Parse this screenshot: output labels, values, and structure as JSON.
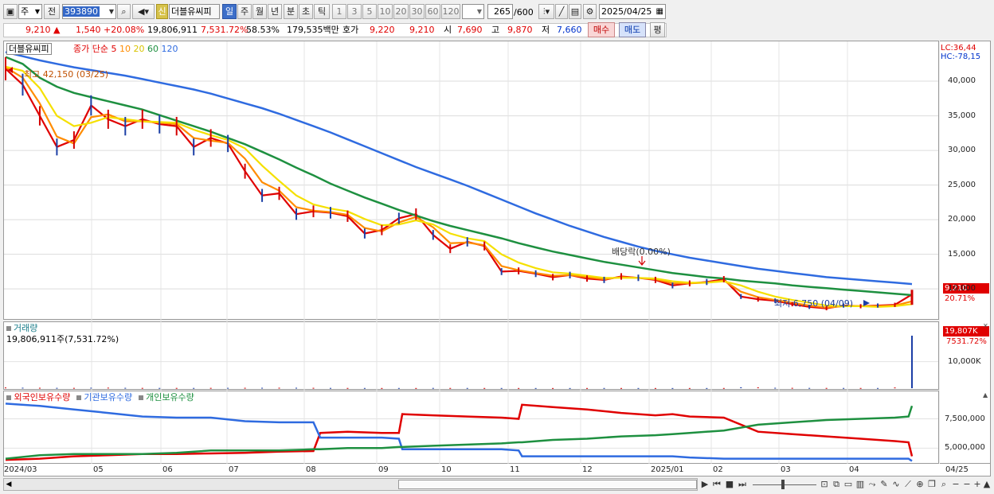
{
  "toolbar": {
    "icon_left": "screen-icon",
    "market_select": "주",
    "prev_label": "전",
    "code": "393890",
    "new_label": "신",
    "stock_name": "더블유씨피",
    "periods": [
      "일",
      "주",
      "월",
      "년",
      "분",
      "초",
      "틱"
    ],
    "active_period": "일",
    "intervals": [
      "1",
      "3",
      "5",
      "10",
      "20",
      "30",
      "60",
      "120"
    ],
    "count": "265",
    "count_max": "/600",
    "date": "2025/04/25"
  },
  "quote": {
    "price": "9,210",
    "change": "1,540",
    "change_pct": "+20.08%",
    "volume": "19,806,911",
    "volume_ratio": "7,531.72%",
    "turnover_pct": "58.53%",
    "amount": "179,535백만",
    "ask_label": "호가",
    "ask": "9,220",
    "bid": "9,210",
    "open_label": "시",
    "open": "7,690",
    "high_label": "고",
    "high": "9,870",
    "low_label": "저",
    "low": "7,660",
    "buy_label": "매수",
    "sell_label": "매도",
    "eval_label": "평"
  },
  "chart_data": [
    {
      "type": "line",
      "title": "더블유씨피",
      "legend": {
        "label": "종가 단순",
        "periods": [
          "5",
          "10",
          "20",
          "60",
          "120"
        ],
        "colors": [
          "#e00000",
          "#ff8c00",
          "#f5e000",
          "#1e9040",
          "#2f6be0"
        ]
      },
      "x_ticks": [
        "2024/03",
        "05",
        "06",
        "07",
        "08",
        "09",
        "10",
        "11",
        "12",
        "2025/01",
        "02",
        "03",
        "04",
        "04/25"
      ],
      "y_ticks": [
        10000,
        15000,
        20000,
        25000,
        30000,
        35000,
        40000
      ],
      "y_tick_labels": [
        "10,000",
        "15,000",
        "20,000",
        "25,000",
        "30,000",
        "35,000",
        "40,000"
      ],
      "ylim": [
        6000,
        44600
      ],
      "lc": "LC:36,44",
      "hc": "HC:-78,15",
      "max_annotation": "최고 42,150 (03/25)",
      "min_annotation": "최저 6,750 (04/09)",
      "dividend_annotation": "배당락(0.00%)",
      "current_price": "9,210",
      "current_change": "20.71%",
      "x": [
        0,
        5,
        10,
        15,
        20,
        25,
        30,
        35,
        40,
        45,
        50,
        55,
        60,
        65,
        70,
        75,
        80,
        85,
        90,
        95,
        100,
        105,
        110,
        115,
        120,
        125,
        130,
        135,
        140,
        145,
        150,
        155,
        160,
        165,
        170,
        175,
        180,
        185,
        190,
        195,
        200,
        205,
        210,
        215,
        220,
        225,
        230,
        235,
        240,
        245,
        250,
        255,
        260,
        265
      ],
      "series": [
        {
          "name": "5",
          "color": "#e00000",
          "values": [
            41800,
            39500,
            35000,
            30500,
            31500,
            36500,
            34500,
            33500,
            34500,
            33800,
            33500,
            30500,
            31800,
            31000,
            27000,
            23500,
            23800,
            20800,
            21200,
            21000,
            20500,
            18000,
            18500,
            20200,
            20800,
            17800,
            15800,
            16800,
            16200,
            12500,
            12600,
            12200,
            11700,
            12000,
            11500,
            11300,
            11800,
            11600,
            11300,
            10500,
            10800,
            11000,
            11400,
            8900,
            8500,
            8300,
            7800,
            7400,
            7200,
            7600,
            7500,
            7600,
            7700,
            9200
          ]
        },
        {
          "name": "10",
          "color": "#ff8c00",
          "values": [
            42000,
            40500,
            36800,
            32000,
            31000,
            34800,
            35200,
            34200,
            34200,
            34000,
            33800,
            31800,
            31400,
            31100,
            28800,
            25400,
            24200,
            21800,
            21300,
            21100,
            20700,
            18800,
            18300,
            19600,
            20400,
            18900,
            16600,
            16700,
            16300,
            13300,
            12700,
            12300,
            11900,
            12000,
            11700,
            11400,
            11700,
            11600,
            11400,
            10800,
            10800,
            10900,
            11200,
            9600,
            8800,
            8400,
            8000,
            7600,
            7300,
            7500,
            7500,
            7500,
            7600,
            8200
          ]
        },
        {
          "name": "20",
          "color": "#f5e000",
          "values": [
            42100,
            41500,
            39000,
            35000,
            33500,
            34000,
            34800,
            34500,
            34200,
            34100,
            34000,
            33000,
            32200,
            31500,
            30300,
            27800,
            25600,
            23500,
            22200,
            21600,
            21200,
            20100,
            19200,
            19300,
            19900,
            19300,
            18000,
            17300,
            16900,
            15000,
            13800,
            13000,
            12400,
            12200,
            11900,
            11600,
            11600,
            11600,
            11500,
            11100,
            10900,
            10900,
            11100,
            10500,
            9600,
            8900,
            8400,
            8000,
            7600,
            7500,
            7500,
            7400,
            7500,
            7800
          ]
        },
        {
          "name": "60",
          "color": "#1e9040",
          "values": [
            43500,
            42500,
            40500,
            39200,
            38300,
            37700,
            37100,
            36500,
            35900,
            35100,
            34300,
            33500,
            32700,
            31800,
            30900,
            29800,
            28700,
            27500,
            26400,
            25200,
            24200,
            23200,
            22300,
            21400,
            20600,
            19800,
            19100,
            18500,
            17900,
            17300,
            16600,
            16000,
            15400,
            14900,
            14400,
            13900,
            13500,
            13100,
            12700,
            12300,
            12000,
            11700,
            11500,
            11200,
            11000,
            10800,
            10500,
            10300,
            10100,
            9900,
            9700,
            9500,
            9300,
            9100
          ]
        },
        {
          "name": "120",
          "color": "#2f6be0",
          "values": [
            44200,
            43600,
            43000,
            42500,
            42000,
            41600,
            41200,
            40800,
            40300,
            39800,
            39300,
            38800,
            38200,
            37500,
            36800,
            36100,
            35300,
            34400,
            33500,
            32600,
            31600,
            30600,
            29600,
            28600,
            27600,
            26700,
            25800,
            24900,
            23900,
            22900,
            21900,
            20900,
            20000,
            19100,
            18300,
            17500,
            16800,
            16100,
            15500,
            15000,
            14500,
            14100,
            13700,
            13300,
            12900,
            12600,
            12300,
            12000,
            11700,
            11500,
            11300,
            11100,
            10900,
            10700
          ]
        }
      ]
    },
    {
      "type": "bar",
      "title": "거래량",
      "value_label": "19,806,911주(7,531.72%)",
      "y_ticks": [
        10000
      ],
      "y_tick_labels": [
        "10,000K"
      ],
      "ylim": [
        0,
        21000
      ],
      "last_label": "19,807K",
      "last_pct": "7531.72%",
      "values_k": [
        260,
        180,
        150,
        120,
        110,
        170,
        200,
        130,
        100,
        90,
        95,
        85,
        110,
        120,
        140,
        150,
        170,
        160,
        130,
        90,
        80,
        70,
        60,
        70,
        65,
        90,
        80,
        75,
        70,
        65,
        60,
        55,
        50,
        55,
        60,
        70,
        65,
        60,
        55,
        50,
        60,
        55,
        70,
        350,
        300,
        150,
        120,
        100,
        90,
        80,
        75,
        70,
        260,
        19807
      ]
    },
    {
      "type": "line",
      "legend": [
        "외국인보유수량",
        "기관보유수량",
        "개인보유수량"
      ],
      "y_ticks": [
        5000000,
        7500000
      ],
      "y_tick_labels": [
        "5,000,000",
        "7,500,000"
      ],
      "ylim": [
        3800000,
        9300000
      ],
      "x": [
        0,
        10,
        20,
        30,
        40,
        50,
        60,
        70,
        80,
        90,
        92,
        100,
        110,
        115,
        116,
        125,
        135,
        145,
        150,
        151,
        160,
        170,
        180,
        190,
        195,
        200,
        210,
        220,
        230,
        240,
        250,
        260,
        264,
        265
      ],
      "series": [
        {
          "name": "외국인보유수량",
          "color": "#e00000",
          "values": [
            4000000,
            4100000,
            4300000,
            4400000,
            4500000,
            4500000,
            4550000,
            4600000,
            4700000,
            4750000,
            6300000,
            6400000,
            6300000,
            6300000,
            7900000,
            7800000,
            7700000,
            7600000,
            7500000,
            8700000,
            8500000,
            8300000,
            8000000,
            7800000,
            7900000,
            7700000,
            7600000,
            6400000,
            6200000,
            6000000,
            5800000,
            5600000,
            5500000,
            4300000
          ]
        },
        {
          "name": "기관보유수량",
          "color": "#2f6be0",
          "values": [
            8800000,
            8600000,
            8300000,
            8000000,
            7700000,
            7600000,
            7600000,
            7300000,
            7200000,
            7200000,
            5900000,
            5900000,
            5900000,
            5800000,
            4900000,
            4900000,
            4900000,
            4900000,
            4800000,
            4300000,
            4300000,
            4300000,
            4300000,
            4300000,
            4300000,
            4200000,
            4100000,
            4100000,
            4100000,
            4100000,
            4100000,
            4100000,
            4100000,
            3900000
          ]
        },
        {
          "name": "개인보유수량",
          "color": "#1e9040",
          "values": [
            4100000,
            4400000,
            4500000,
            4500000,
            4500000,
            4600000,
            4800000,
            4800000,
            4800000,
            4900000,
            4900000,
            5000000,
            5000000,
            5100000,
            5100000,
            5200000,
            5300000,
            5400000,
            5500000,
            5500000,
            5700000,
            5800000,
            6000000,
            6100000,
            6200000,
            6300000,
            6500000,
            7000000,
            7200000,
            7400000,
            7500000,
            7600000,
            7700000,
            8600000
          ]
        }
      ]
    }
  ]
}
